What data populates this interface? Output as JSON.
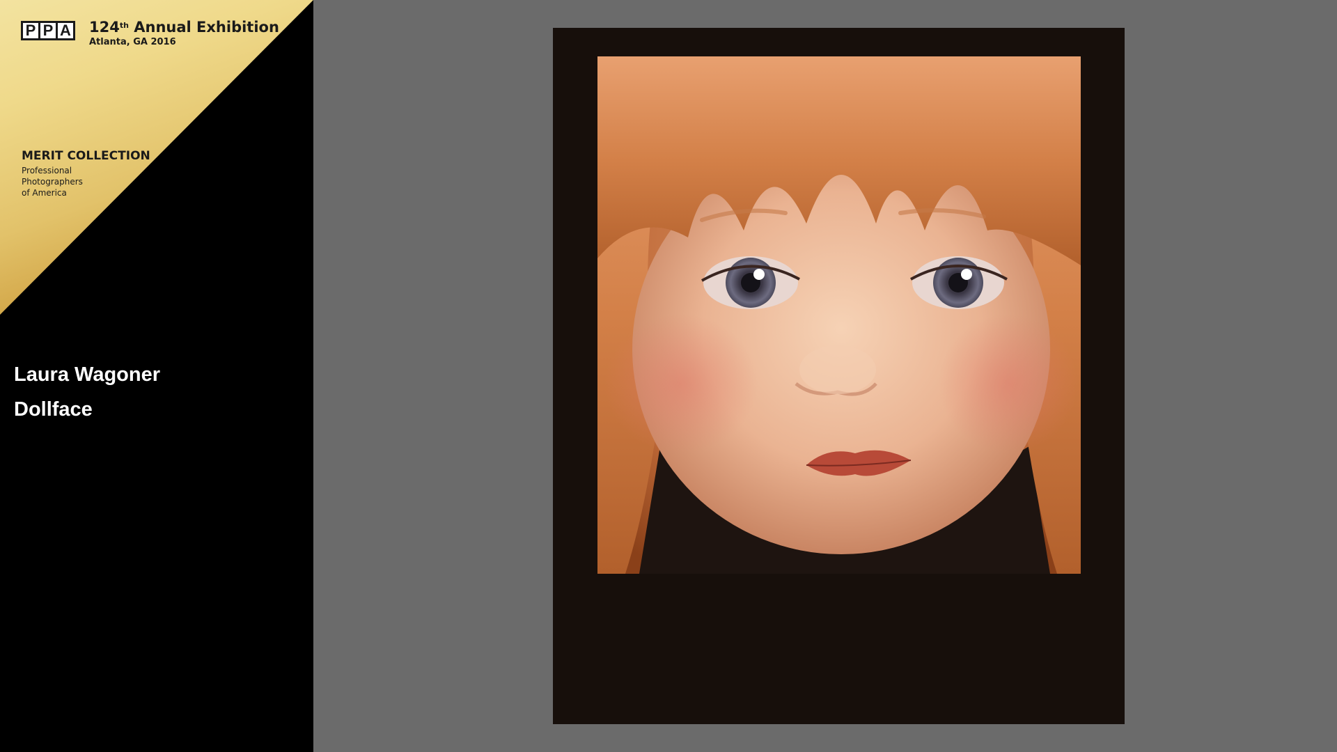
{
  "header": {
    "logo_letters": [
      "P",
      "P",
      "A"
    ],
    "exhibition_number": "124",
    "exhibition_suffix": "th",
    "exhibition_name": "Annual Exhibition",
    "location": "Atlanta, GA 2016"
  },
  "collection": {
    "title": "MERIT COLLECTION",
    "org_lines": [
      "Professional",
      "Photographers",
      "of America"
    ]
  },
  "entry": {
    "artist": "Laura Wagoner",
    "title": "Dollface"
  },
  "colors": {
    "background": "#6b6b6b",
    "sidebar": "#000000",
    "gold": "#e2c26a",
    "frame": "#170f0b"
  },
  "icons": {
    "logo": "ppa-logo"
  }
}
